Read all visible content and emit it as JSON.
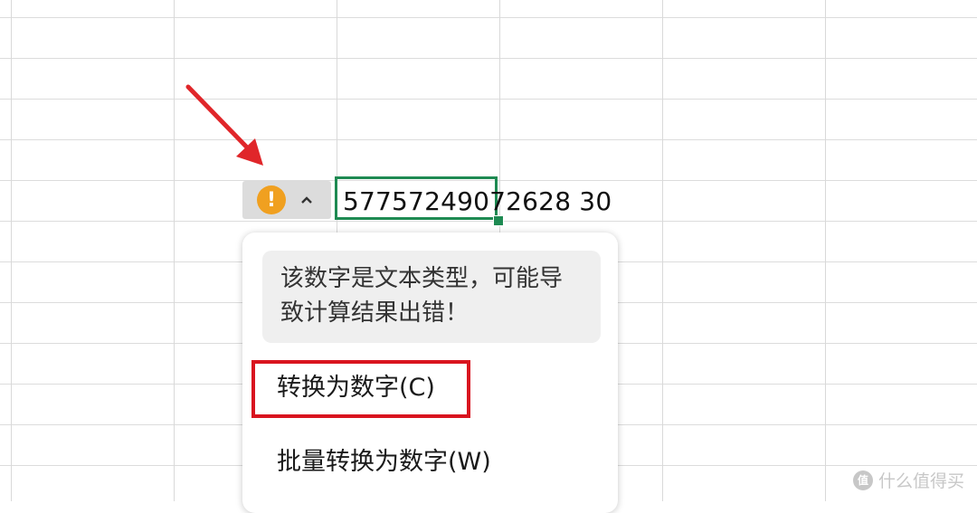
{
  "cell": {
    "value": "57757249072628 30"
  },
  "warning": {
    "icon_glyph": "!",
    "message": "该数字是文本类型，可能导致计算结果出错！",
    "icon_color": "#f0a020"
  },
  "menu": {
    "convert_label": "转换为数字(C)",
    "batch_label": "批量转换为数字(W)"
  },
  "colors": {
    "selection_border": "#1e8a52",
    "annotation_red": "#d9141f"
  },
  "watermark": {
    "icon": "值",
    "text": "什么值得买"
  }
}
